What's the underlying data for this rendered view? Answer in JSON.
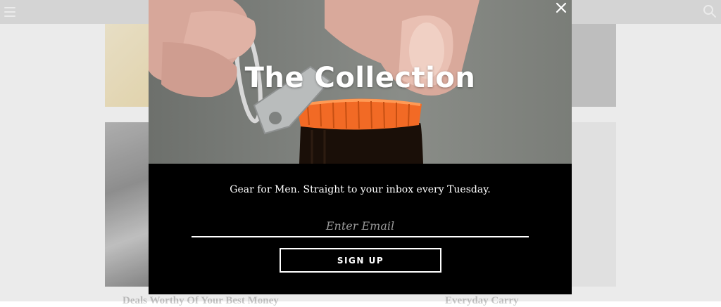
{
  "header": {
    "menu_icon": "hamburger-menu-icon",
    "search_icon": "search-icon"
  },
  "background": {
    "headline_left": "Deals Worthy Of Your Best Money",
    "headline_right": "Everyday Carry"
  },
  "modal": {
    "title": "The Collection",
    "tagline": "Gear for Men. Straight to your inbox every Tuesday.",
    "email_placeholder": "Enter Email",
    "email_value": "",
    "signup_label": "SIGN UP",
    "close_icon": "close-icon",
    "hero_image": "keychain bottle opener opening a bottle",
    "colors": {
      "modal_background": "#000000",
      "text": "#ffffff",
      "bottle_cap": "#f26a25"
    }
  }
}
